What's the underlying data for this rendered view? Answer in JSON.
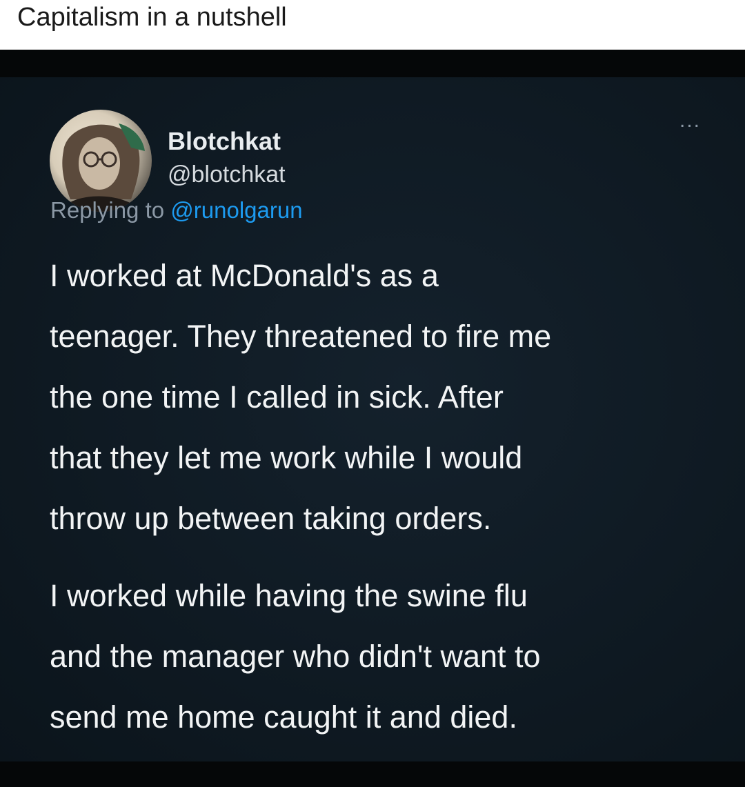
{
  "caption": "Capitalism in a nutshell",
  "tweet": {
    "display_name": "Blotchkat",
    "handle": "@blotchkat",
    "more_label": "...",
    "replying_prefix": "Replying to",
    "replying_to": "@runolgarun",
    "paragraphs": [
      {
        "lines": [
          "I worked at McDonald's as a",
          "teenager. They threatened to fire me",
          "the one time I called in sick. After",
          "that they let me work while I would",
          "throw up between taking orders."
        ]
      },
      {
        "lines": [
          "I worked while having the swine flu",
          "and the manager who didn't want to",
          "send me home caught it and died."
        ]
      }
    ]
  },
  "icons": {
    "avatar": "profile-photo",
    "more": "more-options-icon"
  },
  "colors": {
    "background": "#0f1a23",
    "text": "#f2f4f5",
    "secondary": "#8b98a5",
    "link": "#1d9bf0"
  }
}
